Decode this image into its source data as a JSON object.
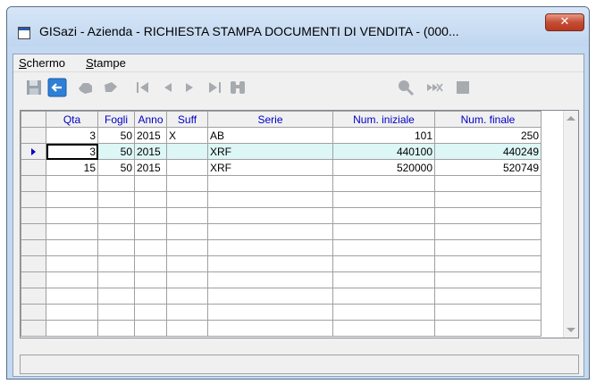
{
  "window": {
    "title": "GISazi - Azienda - RICHIESTA STAMPA DOCUMENTI DI VENDITA - (000..."
  },
  "menu": [
    {
      "label": "Schermo",
      "accel": "S"
    },
    {
      "label": "Stampe",
      "accel": "S"
    }
  ],
  "toolbar": {
    "icons": [
      "save-icon",
      "back-icon",
      "hand-icon",
      "hand-right-icon",
      "first-icon",
      "prev-icon",
      "next-icon",
      "last-icon",
      "binoculars-icon",
      "search-icon",
      "forward-all-icon",
      "stop-icon"
    ]
  },
  "grid": {
    "columns": [
      "Qta",
      "Fogli",
      "Anno",
      "Suff",
      "Serie",
      "Num. iniziale",
      "Num. finale"
    ],
    "rows": [
      [
        "3",
        "50",
        "2015",
        "X",
        "AB",
        "101",
        "250"
      ],
      [
        "3",
        "50",
        "2015",
        "",
        "XRF",
        "440100",
        "440249"
      ],
      [
        "15",
        "50",
        "2015",
        "",
        "XRF",
        "520000",
        "520749"
      ]
    ],
    "empty_rows": 10,
    "selected_row": 1
  },
  "colors": {
    "header_text": "#0000c8",
    "selected_row": "#ddf6f6"
  }
}
